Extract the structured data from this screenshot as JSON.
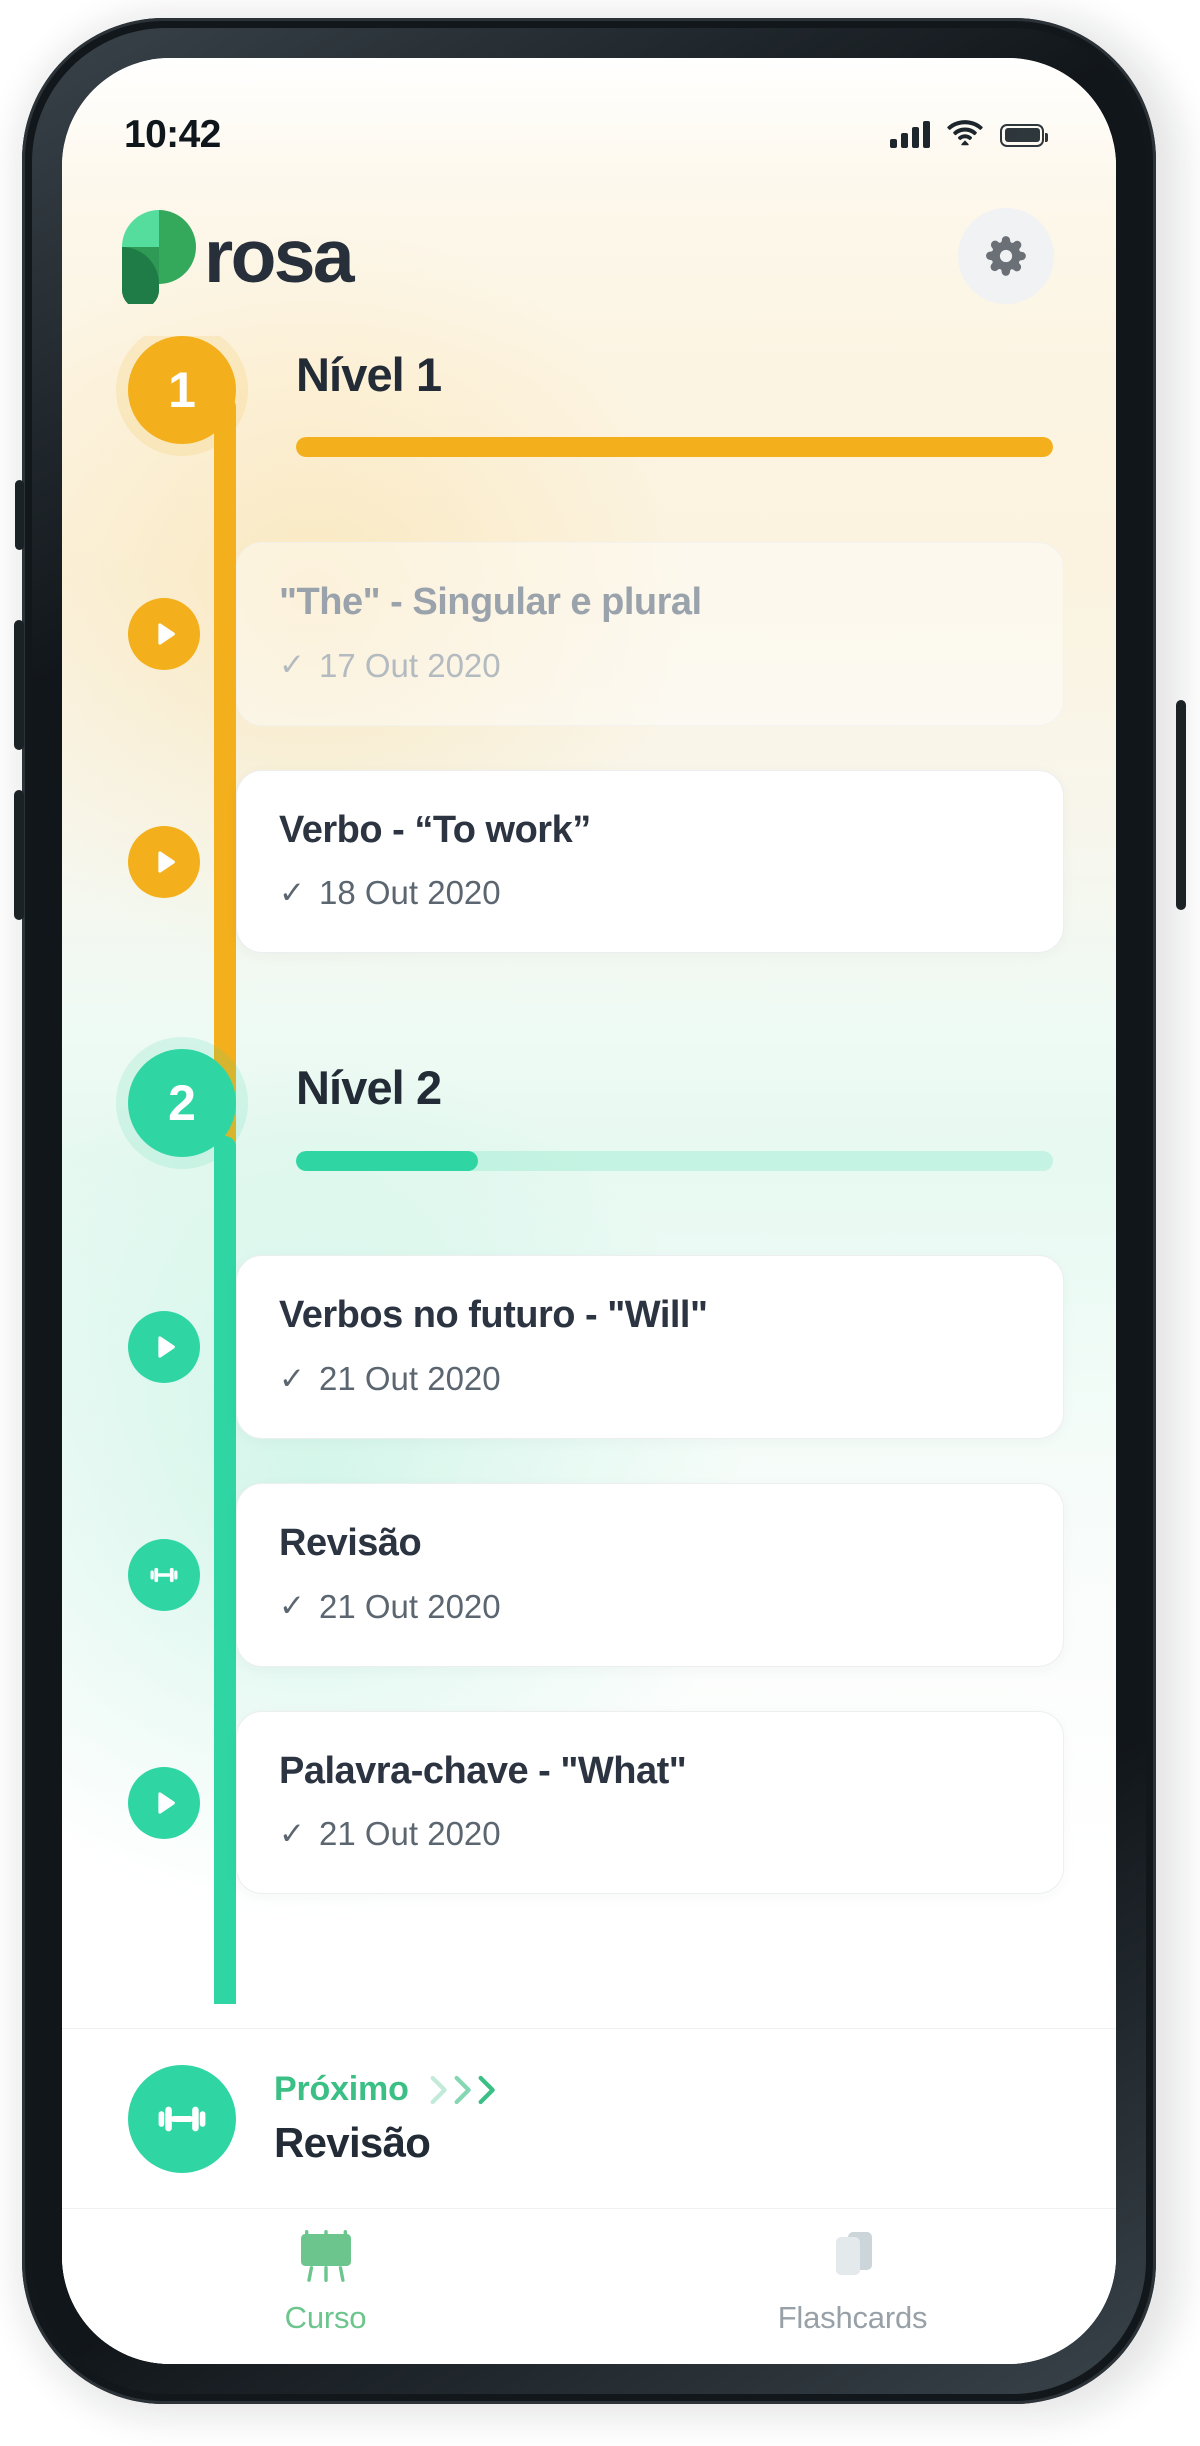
{
  "status_bar": {
    "time": "10:42",
    "signal_icon": "cellular-signal-icon",
    "wifi_icon": "wifi-icon",
    "battery_icon": "battery-full-icon"
  },
  "header": {
    "brand_name": "rosa",
    "brand_full": "prosa",
    "logo_icon": "prosa-leaf-logo-icon",
    "settings_icon": "gear-icon",
    "settings_label": "Configurações"
  },
  "colors": {
    "amber": "#f3b01c",
    "mint": "#2fd6a4",
    "mint_text": "#3bbf85",
    "tab_active": "#6cc58c",
    "tab_inactive": "#98a1a8",
    "title_dark": "#232c36",
    "muted": "#9aa3ab"
  },
  "levels": [
    {
      "number": "1",
      "title": "Nível 1",
      "accent": "amber",
      "progress_percent": 100,
      "lessons": [
        {
          "title": "\"The\" - Singular e plural",
          "date": "17 Out 2020",
          "check": "✓",
          "icon": "play-icon",
          "state": "faded"
        },
        {
          "title": "Verbo - “To work”",
          "date": "18 Out 2020",
          "check": "✓",
          "icon": "play-icon",
          "state": "normal"
        }
      ]
    },
    {
      "number": "2",
      "title": "Nível 2",
      "accent": "mint",
      "progress_percent": 24,
      "lessons": [
        {
          "title": "Verbos no futuro - \"Will\"",
          "date": "21 Out 2020",
          "check": "✓",
          "icon": "play-icon",
          "state": "normal"
        },
        {
          "title": "Revisão",
          "date": "21 Out 2020",
          "check": "✓",
          "icon": "dumbbell-icon",
          "state": "normal"
        },
        {
          "title": "Palavra-chave - \"What\"",
          "date": "21 Out 2020",
          "check": "✓",
          "icon": "play-icon",
          "state": "normal"
        }
      ]
    }
  ],
  "next_bar": {
    "label": "Próximo",
    "title": "Revisão",
    "icon": "dumbbell-icon",
    "chevron_icon": "chevron-right-icon"
  },
  "tab_bar": {
    "tabs": [
      {
        "label": "Curso",
        "icon": "easel-board-icon",
        "active": true
      },
      {
        "label": "Flashcards",
        "icon": "cards-stack-icon",
        "active": false
      }
    ]
  }
}
